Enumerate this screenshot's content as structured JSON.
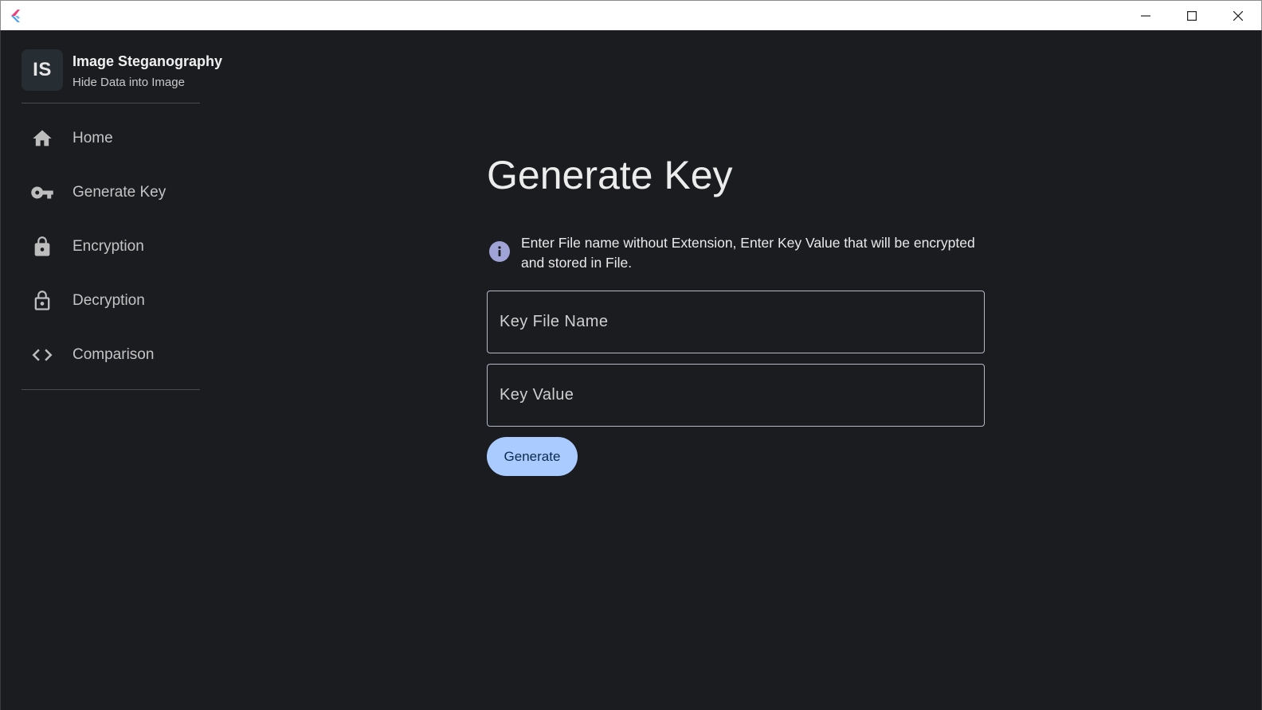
{
  "titlebar": {
    "app_icon": "flutter-logo-icon",
    "controls": [
      "minimize-icon",
      "maximize-icon",
      "close-icon"
    ]
  },
  "brand": {
    "badge": "IS",
    "title": "Image Steganography",
    "subtitle": "Hide Data into Image"
  },
  "nav": {
    "items": [
      {
        "label": "Home",
        "icon": "home-icon"
      },
      {
        "label": "Generate Key",
        "icon": "key-icon"
      },
      {
        "label": "Encryption",
        "icon": "lock-icon"
      },
      {
        "label": "Decryption",
        "icon": "lock-open-icon"
      },
      {
        "label": "Comparison",
        "icon": "code-icon"
      }
    ]
  },
  "main": {
    "heading": "Generate Key",
    "info": "Enter File name without Extension, Enter Key Value that will be encrypted and stored in File.",
    "key_file_name": {
      "value": "",
      "placeholder": "Key File Name"
    },
    "key_value": {
      "value": "",
      "placeholder": "Key Value"
    },
    "generate_label": "Generate"
  },
  "colors": {
    "background": "#1b1c1f",
    "button": "#a9cbff",
    "button_text": "#0d2b4e",
    "info_icon": "#9fa3d6"
  }
}
